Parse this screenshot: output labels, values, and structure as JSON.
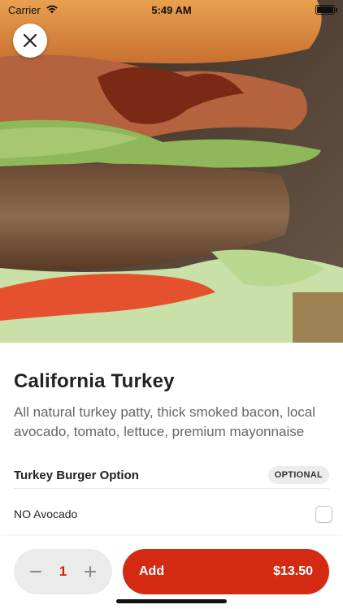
{
  "status_bar": {
    "carrier": "Carrier",
    "time": "5:49 AM",
    "wifi_icon": "wifi-icon",
    "battery_level": 1.0
  },
  "hero": {
    "icon": "close-icon"
  },
  "item": {
    "title": "California Turkey",
    "description": "All natural turkey patty, thick smoked bacon, local avocado, tomato, lettuce, premium mayonnaise"
  },
  "option_group": {
    "title": "Turkey Burger Option",
    "badge": "OPTIONAL",
    "options": [
      {
        "label": "NO Avocado",
        "checked": false
      }
    ]
  },
  "cart": {
    "minus_icon": "minus-icon",
    "plus_icon": "plus-icon",
    "quantity": "1",
    "add_label": "Add",
    "price": "$13.50"
  },
  "colors": {
    "accent": "#d42a12",
    "quantity_text": "#d41f0b",
    "badge_bg": "#ececec"
  }
}
